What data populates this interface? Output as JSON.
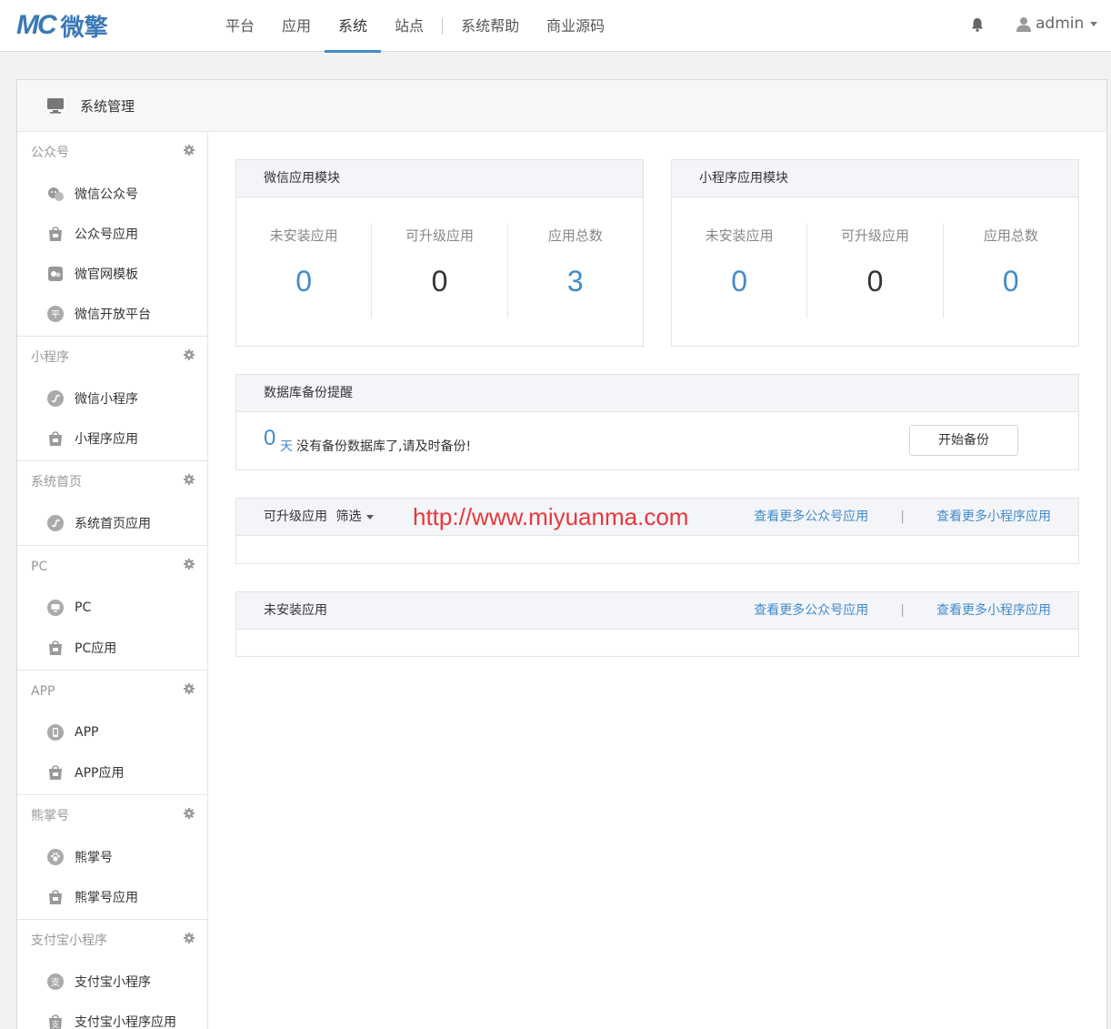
{
  "brand": {
    "mark": "MC",
    "name": "微擎"
  },
  "nav": [
    "平台",
    "应用",
    "系统",
    "站点",
    "系统帮助",
    "商业源码"
  ],
  "user": {
    "name": "admin"
  },
  "panel": {
    "title": "系统管理"
  },
  "sidebar": [
    {
      "title": "公众号",
      "items": [
        {
          "label": "微信公众号",
          "icon": "wechat-icon"
        },
        {
          "label": "公众号应用",
          "icon": "app-bag-icon"
        },
        {
          "label": "微官网模板",
          "icon": "template-icon"
        },
        {
          "label": "微信开放平台",
          "icon": "open-platform-icon"
        }
      ]
    },
    {
      "title": "小程序",
      "items": [
        {
          "label": "微信小程序",
          "icon": "miniprogram-icon"
        },
        {
          "label": "小程序应用",
          "icon": "app-bag-icon"
        }
      ]
    },
    {
      "title": "系统首页",
      "items": [
        {
          "label": "系统首页应用",
          "icon": "miniprogram-icon"
        }
      ]
    },
    {
      "title": "PC",
      "items": [
        {
          "label": "PC",
          "icon": "monitor-icon"
        },
        {
          "label": "PC应用",
          "icon": "app-bag-icon"
        }
      ]
    },
    {
      "title": "APP",
      "items": [
        {
          "label": "APP",
          "icon": "phone-icon"
        },
        {
          "label": "APP应用",
          "icon": "app-bag-icon"
        }
      ]
    },
    {
      "title": "熊掌号",
      "items": [
        {
          "label": "熊掌号",
          "icon": "paw-icon"
        },
        {
          "label": "熊掌号应用",
          "icon": "app-bag-icon"
        }
      ]
    },
    {
      "title": "支付宝小程序",
      "items": [
        {
          "label": "支付宝小程序",
          "icon": "alipay-icon"
        },
        {
          "label": "支付宝小程序应用",
          "icon": "alipay-bag-icon"
        }
      ]
    }
  ],
  "wechat_module": {
    "title": "微信应用模块",
    "stats": [
      {
        "label": "未安装应用",
        "value": "0"
      },
      {
        "label": "可升级应用",
        "value": "0"
      },
      {
        "label": "应用总数",
        "value": "3"
      }
    ]
  },
  "mini_module": {
    "title": "小程序应用模块",
    "stats": [
      {
        "label": "未安装应用",
        "value": "0"
      },
      {
        "label": "可升级应用",
        "value": "0"
      },
      {
        "label": "应用总数",
        "value": "0"
      }
    ]
  },
  "backup": {
    "title": "数据库备份提醒",
    "days": "0",
    "unit": "天",
    "message": "没有备份数据库了,请及时备份!",
    "button": "开始备份"
  },
  "upgradable": {
    "title": "可升级应用",
    "filter": "筛选",
    "watermark": "http://www.miyuanma.com",
    "link_oa": "查看更多公众号应用",
    "separator": "|",
    "link_mini": "查看更多小程序应用"
  },
  "uninstalled": {
    "title": "未安装应用",
    "link_oa": "查看更多公众号应用",
    "separator": "|",
    "link_mini": "查看更多小程序应用"
  },
  "colors": {
    "accent": "#428bca",
    "watermark": "#e8373a"
  }
}
